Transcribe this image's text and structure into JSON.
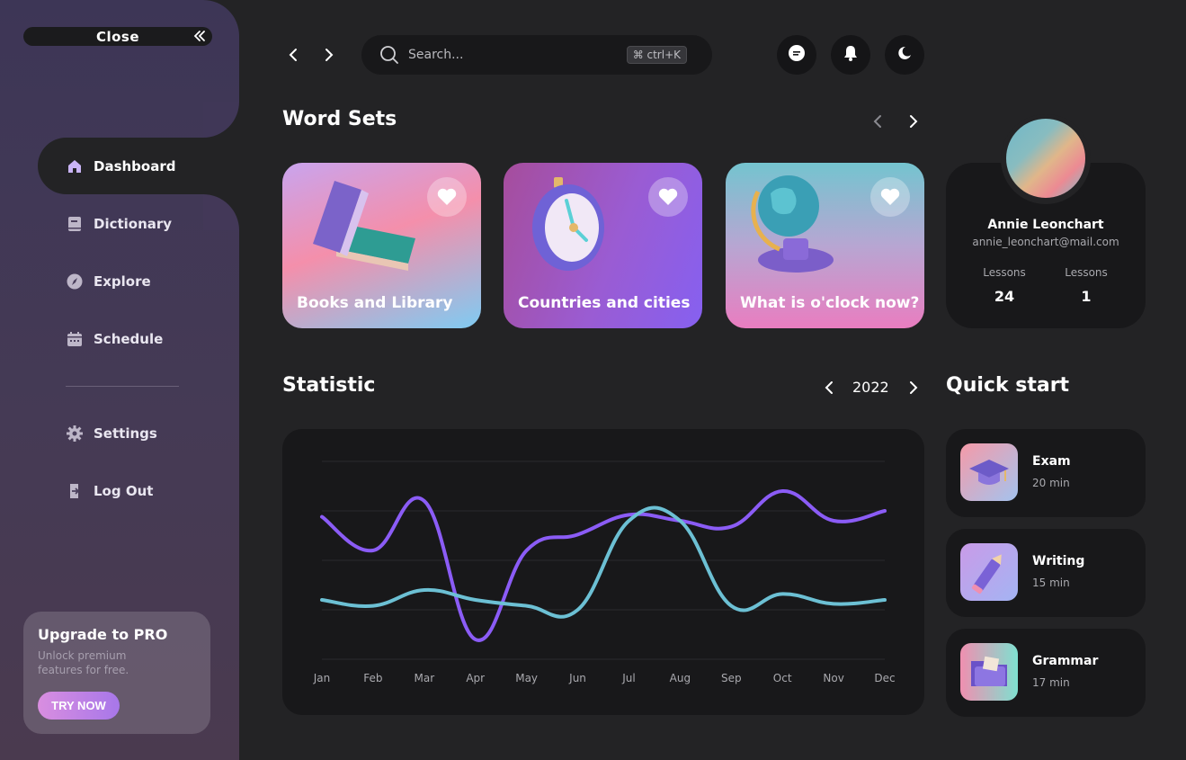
{
  "sidebar": {
    "close_label": "Close",
    "nav": [
      {
        "label": "Dashboard",
        "icon": "home-icon",
        "active": true
      },
      {
        "label": "Dictionary",
        "icon": "book-icon"
      },
      {
        "label": "Explore",
        "icon": "compass-icon"
      },
      {
        "label": "Schedule",
        "icon": "calendar-icon"
      }
    ],
    "secondary_nav": [
      {
        "label": "Settings",
        "icon": "gear-icon"
      },
      {
        "label": "Log Out",
        "icon": "logout-icon"
      }
    ],
    "upgrade": {
      "title": "Upgrade to PRO",
      "subtitle": "Unlock premium features for free.",
      "button": "TRY NOW"
    }
  },
  "topbar": {
    "search_placeholder": "Search...",
    "shortcut": "⌘ ctrl+K"
  },
  "word_sets": {
    "title": "Word Sets",
    "cards": [
      {
        "title": "Books and Library"
      },
      {
        "title": "Countries and cities"
      },
      {
        "title": "What is o'clock now?"
      }
    ]
  },
  "profile": {
    "name": "Annie Leonchart",
    "email": "annie_leonchart@mail.com",
    "stats": [
      {
        "label": "Lessons",
        "value": "24"
      },
      {
        "label": "Lessons",
        "value": "1"
      }
    ]
  },
  "statistic": {
    "title": "Statistic",
    "year": "2022"
  },
  "quick_start": {
    "title": "Quick start",
    "items": [
      {
        "title": "Exam",
        "meta": "20 min"
      },
      {
        "title": "Writing",
        "meta": "15 min"
      },
      {
        "title": "Grammar",
        "meta": "17 min"
      }
    ]
  },
  "colors": {
    "accent_purple": "#8b5cf6",
    "accent_teal": "#6cc0d4",
    "background": "#232325",
    "panel": "#18181a"
  },
  "chart_data": {
    "type": "line",
    "categories": [
      "Jan",
      "Feb",
      "Mar",
      "Apr",
      "May",
      "Jun",
      "Jul",
      "Aug",
      "Sep",
      "Oct",
      "Nov",
      "Dec"
    ],
    "ylim": [
      0,
      100
    ],
    "grid": true,
    "series": [
      {
        "color": "#8b5cf6",
        "values": [
          72,
          55,
          80,
          10,
          55,
          63,
          73,
          70,
          67,
          85,
          70,
          75
        ]
      },
      {
        "color": "#6cc0d4",
        "values": [
          30,
          27,
          35,
          30,
          27,
          25,
          70,
          70,
          27,
          33,
          28,
          30
        ]
      }
    ]
  }
}
